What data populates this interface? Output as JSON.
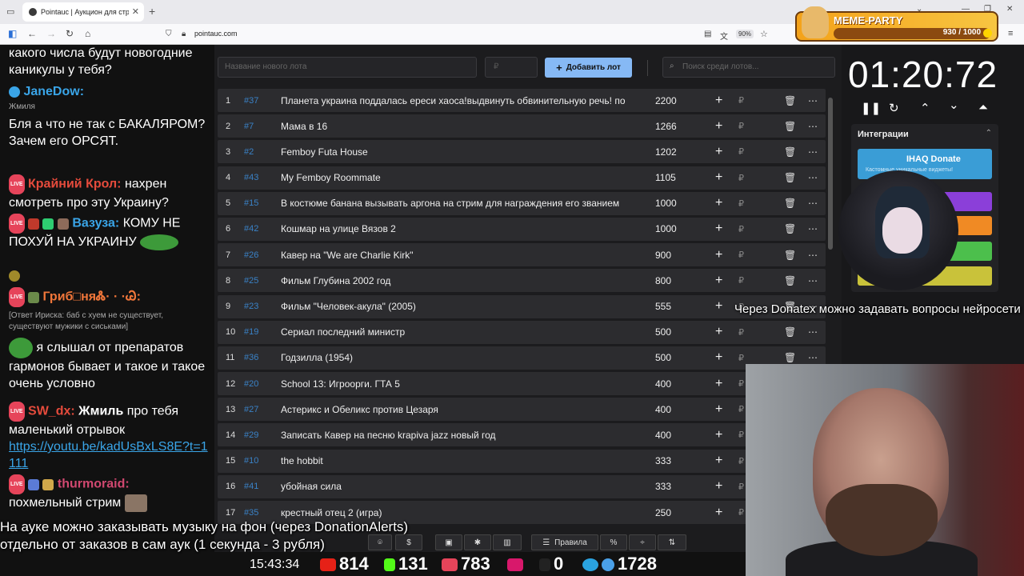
{
  "browser": {
    "tab_title": "Pointauc | Аукцион для стримеров",
    "url": "pointauc.com",
    "zoom": "90%"
  },
  "meme_party": {
    "title": "MEME-PARTY",
    "score": "930 / 1000"
  },
  "chat": {
    "messages": [
      {
        "text": "какого числа будут новогодние каникулы у тебя?"
      },
      {
        "nick": "JaneDow:",
        "sub": "Жмиля",
        "text": "Бля а что не так с БАКАЛЯРОМ? Зачем его ОРСЯТ."
      },
      {
        "nick": "Крайний Крол:",
        "text": "нахрен смотреть про эту Украину?"
      },
      {
        "nick": "Вазуза:",
        "text": "КОМУ НЕ ПОХУЙ НА УКРАИНУ"
      },
      {
        "nick": "Гриб□няᏜ· · ·Ꮚ:",
        "reply": "[Ответ Ириска: баб с хуем не существует, существуют мужики с сиськами]",
        "text": "я слышал от препаратов гармонов бывает и такое и такое очень условно"
      },
      {
        "nick": "SW_dx:",
        "bold": "Жмиль",
        "text": " про тебя маленький отрывок",
        "link": "https://youtu.be/kadUsBxLS8E?t=1111"
      },
      {
        "nick": "thurmoraid:",
        "text": "похмельный стрим"
      }
    ]
  },
  "auction": {
    "new_lot_placeholder": "Название нового лота",
    "price_placeholder": "₽",
    "add_button": "Добавить лот",
    "search_placeholder": "Поиск среди лотов...",
    "lots": [
      {
        "n": "1",
        "id": "#37",
        "name": "Планета украина поддалась ереси хаоса!выдвинуть обвинительную речь! по",
        "amount": "2200"
      },
      {
        "n": "2",
        "id": "#7",
        "name": "Мама в 16",
        "amount": "1266"
      },
      {
        "n": "3",
        "id": "#2",
        "name": "Femboy Futa House",
        "amount": "1202"
      },
      {
        "n": "4",
        "id": "#43",
        "name": "My Femboy Roommate",
        "amount": "1105"
      },
      {
        "n": "5",
        "id": "#15",
        "name": "В костюме банана вызывать аргона на стрим для награждения его званием",
        "amount": "1000"
      },
      {
        "n": "6",
        "id": "#42",
        "name": "Кошмар на улице Вязов 2",
        "amount": "1000"
      },
      {
        "n": "7",
        "id": "#26",
        "name": "Кавер на \"We are Charlie Kirk\"",
        "amount": "900"
      },
      {
        "n": "8",
        "id": "#25",
        "name": "Фильм Глубина 2002 год",
        "amount": "800"
      },
      {
        "n": "9",
        "id": "#23",
        "name": "Фильм \"Человек-акула\" (2005)",
        "amount": "555"
      },
      {
        "n": "10",
        "id": "#19",
        "name": "Сериал последний министр",
        "amount": "500"
      },
      {
        "n": "11",
        "id": "#36",
        "name": "Годзилла (1954)",
        "amount": "500"
      },
      {
        "n": "12",
        "id": "#20",
        "name": "School 13: Игроорги. ГТА 5",
        "amount": "400"
      },
      {
        "n": "13",
        "id": "#27",
        "name": "Астерикс и Обеликс против Цезаря",
        "amount": "400"
      },
      {
        "n": "14",
        "id": "#29",
        "name": "Записать Кавер на песню krapiva jazz новый год",
        "amount": "400"
      },
      {
        "n": "15",
        "id": "#10",
        "name": "the hobbit",
        "amount": "333"
      },
      {
        "n": "16",
        "id": "#41",
        "name": "убойная сила",
        "amount": "333"
      },
      {
        "n": "17",
        "id": "#35",
        "name": "крестный отец 2 (игра)",
        "amount": "250"
      }
    ],
    "rules_label": "Правила",
    "percent_label": "%"
  },
  "timer": "01:20:72",
  "integrations": {
    "header": "Интеграции",
    "donate_title": "IHAQ Donate",
    "donate_sub": "Кастомные уникальные виджеты!",
    "last_label": "uet"
  },
  "overlay": {
    "subtitle_right": "Через Donatex можно задавать вопросы нейросети",
    "subtitle_bottom_1": "На ауке можно заказывать музыку на фон (через DonationAlerts)",
    "subtitle_bottom_2": "отдельно от заказов в сам аук (1 секунда - 3 рубля)"
  },
  "stats": {
    "clock": "15:43:34",
    "youtube": "814",
    "kick": "131",
    "vk": "783",
    "rumble": "0",
    "telegram": "1728"
  },
  "colors": {
    "accent": "#86b9f5",
    "lot_bg": "#2c2c2f",
    "id_color": "#3a82c7"
  }
}
